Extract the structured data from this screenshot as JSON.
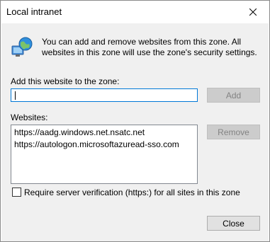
{
  "window": {
    "title": "Local intranet"
  },
  "icons": {
    "zone": "globe-computer-icon",
    "close": "close-icon"
  },
  "intro_text": "You can add and remove websites from this zone. All websites in this zone will use the zone's security settings.",
  "add_section": {
    "label": "Add this website to the zone:",
    "input_value": "",
    "add_button": "Add"
  },
  "websites": {
    "label": "Websites:",
    "items": [
      "https://aadg.windows.net.nsatc.net",
      "https://autologon.microsoftazuread-sso.com"
    ],
    "remove_button": "Remove"
  },
  "require_https": {
    "label": "Require server verification (https:) for all sites in this zone",
    "checked": false
  },
  "close_button": "Close"
}
